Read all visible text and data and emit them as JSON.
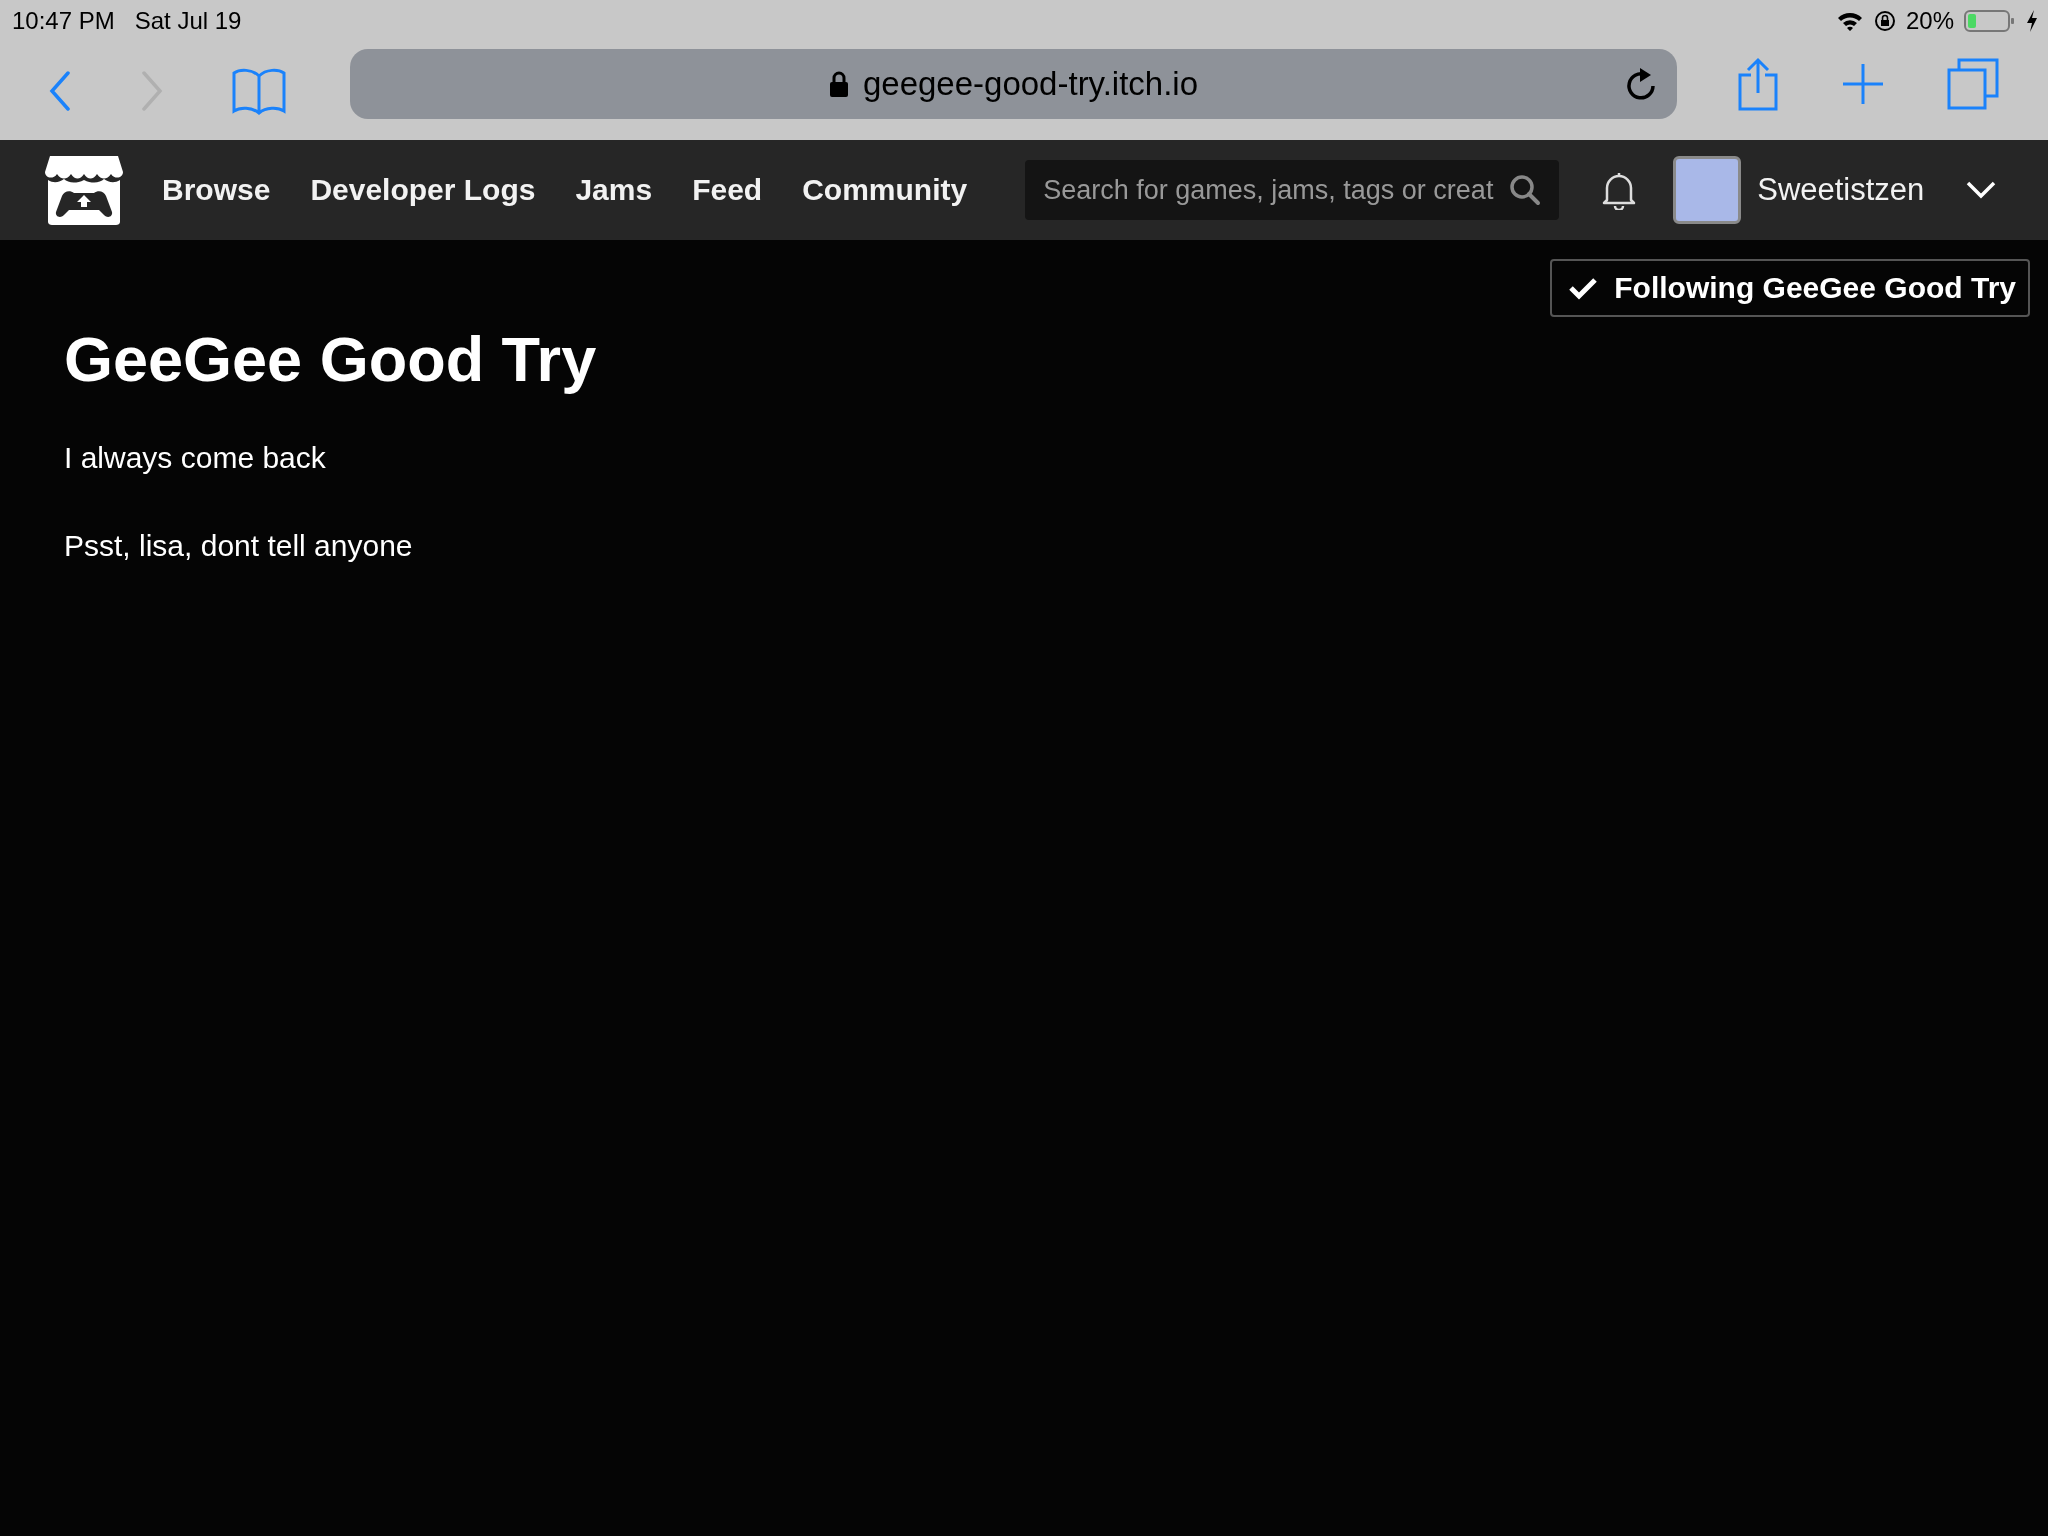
{
  "status_bar": {
    "time": "10:47 PM",
    "date": "Sat Jul 19",
    "battery": "20%"
  },
  "browser": {
    "url": "geegee-good-try.itch.io",
    "back_enabled": true,
    "forward_enabled": false
  },
  "nav": {
    "links": [
      "Browse",
      "Developer Logs",
      "Jams",
      "Feed",
      "Community"
    ],
    "search": {
      "placeholder": "Search for games, jams, tags or creat"
    },
    "username": "Sweetistzen"
  },
  "follow_button": {
    "label": "Following GeeGee Good Try",
    "following": true
  },
  "page": {
    "title": "GeeGee Good Try",
    "paragraphs": [
      "I always come back",
      "Psst, lisa, dont tell anyone"
    ]
  }
}
